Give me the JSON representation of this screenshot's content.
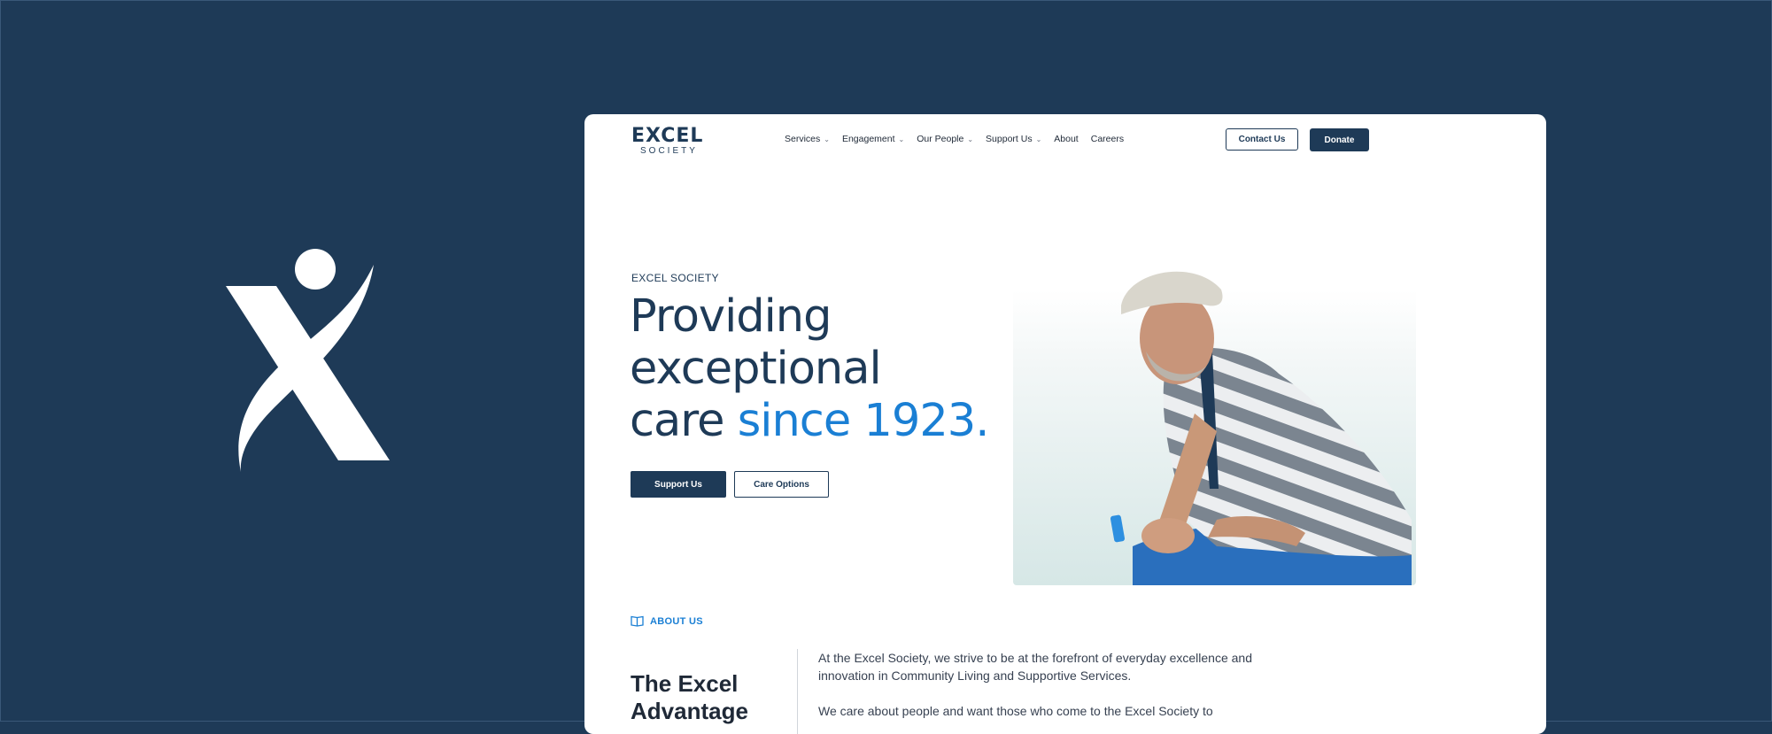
{
  "brand": {
    "logo_top": "EXCEL",
    "logo_bottom": "SOCIETY"
  },
  "nav": {
    "items": [
      {
        "label": "Services",
        "dropdown": true
      },
      {
        "label": "Engagement",
        "dropdown": true
      },
      {
        "label": "Our People",
        "dropdown": true
      },
      {
        "label": "Support Us",
        "dropdown": true
      },
      {
        "label": "About",
        "dropdown": false
      },
      {
        "label": "Careers",
        "dropdown": false
      }
    ],
    "contact_label": "Contact Us",
    "donate_label": "Donate"
  },
  "hero": {
    "eyebrow": "EXCEL SOCIETY",
    "headline_line1": "Providing",
    "headline_line2": "exceptional",
    "headline_line3_plain": "care ",
    "headline_line3_highlight": "since 1923.",
    "support_label": "Support Us",
    "care_label": "Care Options"
  },
  "about": {
    "tag": "ABOUT US",
    "title": "The Excel Advantage",
    "paragraph1": "At the Excel Society, we strive to be at the forefront of everyday excellence and innovation in Community Living and Supportive Services.",
    "paragraph2": "We care about people and want those who come to the Excel Society to"
  },
  "colors": {
    "navy": "#1e3a57",
    "accent_blue": "#1a7fd4",
    "background": "#1e3a57",
    "card": "#ffffff"
  }
}
